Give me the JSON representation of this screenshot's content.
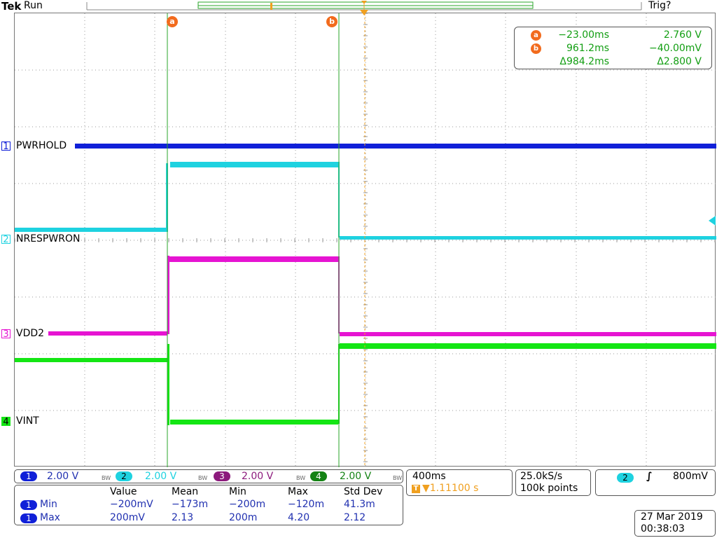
{
  "status": {
    "brand": "Tek",
    "run_state": "Run",
    "trigger_state": "Trig?"
  },
  "cursors": {
    "a": {
      "badge": "a",
      "time": "−23.00ms",
      "value": "2.760 V"
    },
    "b": {
      "badge": "b",
      "time": "961.2ms",
      "value": "−40.00mV"
    },
    "delta": {
      "time": "Δ984.2ms",
      "value": "Δ2.800 V"
    }
  },
  "channels": [
    {
      "num": "1",
      "label": "PWRHOLD",
      "scale": "2.00 V",
      "color": "#1020d8"
    },
    {
      "num": "2",
      "label": "NRESPWRON",
      "scale": "2.00 V",
      "color": "#1ed2e0"
    },
    {
      "num": "3",
      "label": "VDD2",
      "scale": "2.00 V",
      "color": "#e614d2"
    },
    {
      "num": "4",
      "label": "VINT",
      "scale": "2.00 V",
      "color": "#14e614"
    }
  ],
  "bw_mark": "BW",
  "timebase": {
    "scale": "400ms",
    "trigger_position": "▼1.11100 s",
    "sample_rate": "25.0kS/s",
    "record_length": "100k points"
  },
  "trigger": {
    "source": "2",
    "slope": "∫",
    "level": "800mV"
  },
  "measurements": {
    "headers": [
      "Value",
      "Mean",
      "Min",
      "Max",
      "Std Dev"
    ],
    "rows": [
      {
        "channel": "1",
        "name": "Min",
        "values": [
          "−200mV",
          "−173m",
          "−200m",
          "−120m",
          "41.3m"
        ]
      },
      {
        "channel": "1",
        "name": "Max",
        "values": [
          "200mV",
          "2.13",
          "200m",
          "4.20",
          "2.12"
        ]
      }
    ]
  },
  "datetime": {
    "date": "27 Mar  2019",
    "time": "00:38:03"
  },
  "colors": {
    "cursor": "#2aa52a",
    "cursor_badge": "#f26b1d",
    "readout_text": "#129e12",
    "value_text": "#2030b0"
  }
}
